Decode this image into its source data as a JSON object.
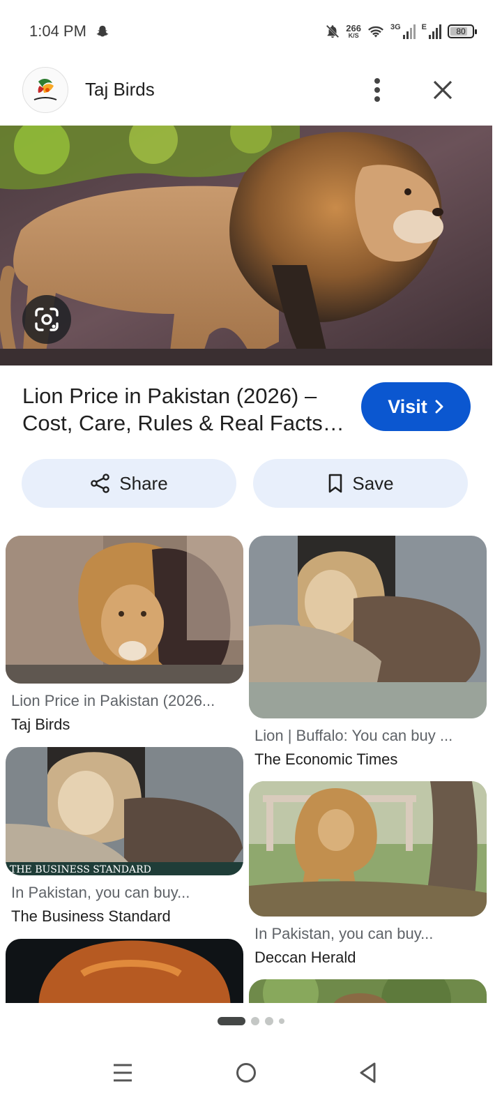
{
  "status_bar": {
    "time": "1:04 PM",
    "net_speed_value": "266",
    "net_speed_unit": "K/S",
    "network_1": "3G",
    "network_2": "E",
    "battery_percent": 80
  },
  "header": {
    "site_name": "Taj Birds",
    "logo_icon": "taj-birds-logo",
    "more_icon": "more-vert-icon",
    "close_icon": "close-icon"
  },
  "hero": {
    "image_subject": "lion",
    "lens_icon": "google-lens-icon"
  },
  "result": {
    "title": "Lion Price in Pakistan (2026) – Cost, Care, Rules & Real Facts…",
    "visit_label": "Visit"
  },
  "actions": {
    "share_label": "Share",
    "save_label": "Save"
  },
  "related": [
    {
      "title": "Lion Price in Pakistan (2026...",
      "source": "Taj Birds"
    },
    {
      "title": "Lion | Buffalo: You can buy ...",
      "source": "The Economic Times"
    },
    {
      "title": "In Pakistan, you can buy...",
      "source": "The Business Standard",
      "watermark": "THE BUSINESS STANDARD"
    },
    {
      "title": "In Pakistan, you can buy...",
      "source": "Deccan Herald"
    }
  ],
  "colors": {
    "accent": "#0b57d0",
    "action_bg": "#e8effb",
    "muted_text": "#5f6368"
  }
}
